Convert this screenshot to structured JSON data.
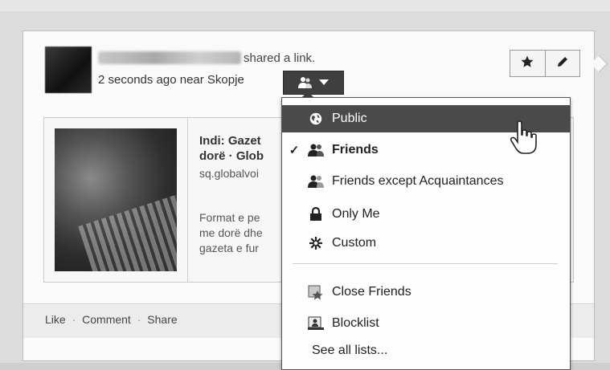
{
  "post": {
    "author_name": "",
    "shared_text": "shared a link.",
    "meta": "2 seconds ago near Skopje",
    "star_icon": "star-icon",
    "edit_icon": "pencil-icon"
  },
  "link": {
    "title_line1": "Indi: Gazet",
    "title_line2": "dorë · Glob",
    "domain": "sq.globalvoi",
    "desc_line1": "Format e pe",
    "desc_line2": "me dorë dhe",
    "desc_line3": "gazeta e fur"
  },
  "footer": {
    "like": "Like",
    "comment": "Comment",
    "share": "Share",
    "separator": "·"
  },
  "audience_menu": {
    "selected_icon": "friends-icon",
    "items": [
      {
        "label": "Public",
        "icon": "globe-icon",
        "checked": false,
        "highlighted": true
      },
      {
        "label": "Friends",
        "icon": "friends-icon",
        "checked": true,
        "highlighted": false
      },
      {
        "label": "Friends except Acquaintances",
        "icon": "friends-except-icon",
        "checked": false,
        "highlighted": false
      },
      {
        "label": "Only Me",
        "icon": "lock-icon",
        "checked": false,
        "highlighted": false
      },
      {
        "label": "Custom",
        "icon": "gear-icon",
        "checked": false,
        "highlighted": false
      }
    ],
    "lists": [
      {
        "label": "Close Friends",
        "icon": "close-friends-icon"
      },
      {
        "label": "Blocklist",
        "icon": "blocklist-icon"
      }
    ],
    "see_all": "See all lists...",
    "check_mark": "✓"
  },
  "colors": {
    "highlight": "#4a4a4a",
    "button_dark": "#3f3f3f"
  }
}
